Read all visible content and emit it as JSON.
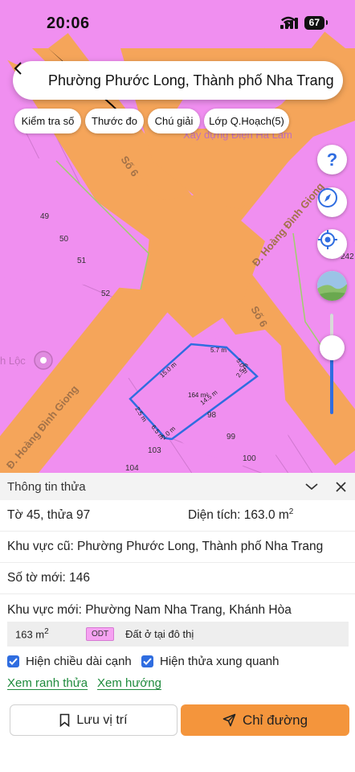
{
  "status_bar": {
    "time": "20:06",
    "battery": "67"
  },
  "search": {
    "text": "Phường Phước Long, Thành phố Nha Trang"
  },
  "chips": [
    {
      "label": "Kiểm tra số"
    },
    {
      "label": "Thước đo"
    },
    {
      "label": "Chú giải"
    },
    {
      "label": "Lớp Q.Hoạch(5)"
    }
  ],
  "map": {
    "poi_top": "Xây dựng Điện Hà Lâm",
    "poi_left": "h Lộc",
    "streets": {
      "so6_top": "Số 6",
      "so6_right": "Số 6",
      "hoang_dinh_right": "Đ. Hoàng Đình Giong",
      "hoang_dinh_left": "Đ. Hoàng Đình Giong"
    },
    "lot_numbers": [
      "49",
      "50",
      "51",
      "52",
      "98",
      "99",
      "100",
      "103",
      "104",
      "242"
    ],
    "dimensions": {
      "top": "5.7 m",
      "upper_left": "15.0 m",
      "right": "5.0 m",
      "right2": "2.5 m",
      "diagonal": "14.5 m",
      "area": "164 m²",
      "left": "2.5 m",
      "bottom1": "6.5 m",
      "bottom2": "2.0 m"
    }
  },
  "panel": {
    "title": "Thông tin thửa",
    "sheet_plot": "Tờ 45, thửa 97",
    "area_label": "Diện tích: 163.0 m",
    "area_sup": "2",
    "old_area": "Khu vực cũ: Phường Phước Long, Thành phố Nha Trang",
    "new_sheet": "Số tờ mới: 146",
    "new_area": "Khu vực mới: Phường Nam Nha Trang, Khánh Hòa",
    "zone": {
      "area": "163 m",
      "area_sup": "2",
      "code": "ODT",
      "description": "Đất ở tại đô thị"
    },
    "checks": [
      {
        "label": "Hiện chiều dài cạnh",
        "checked": true
      },
      {
        "label": "Hiện thửa xung quanh",
        "checked": true
      }
    ],
    "links": [
      {
        "label": "Xem ranh thửa"
      },
      {
        "label": "Xem hướng"
      }
    ],
    "save_label": "Lưu vị trí",
    "route_label": "Chỉ đường"
  },
  "colors": {
    "road": "#f5a55a",
    "land": "#f08ff0",
    "accent": "#f4953c",
    "primary": "#2f6de0"
  }
}
